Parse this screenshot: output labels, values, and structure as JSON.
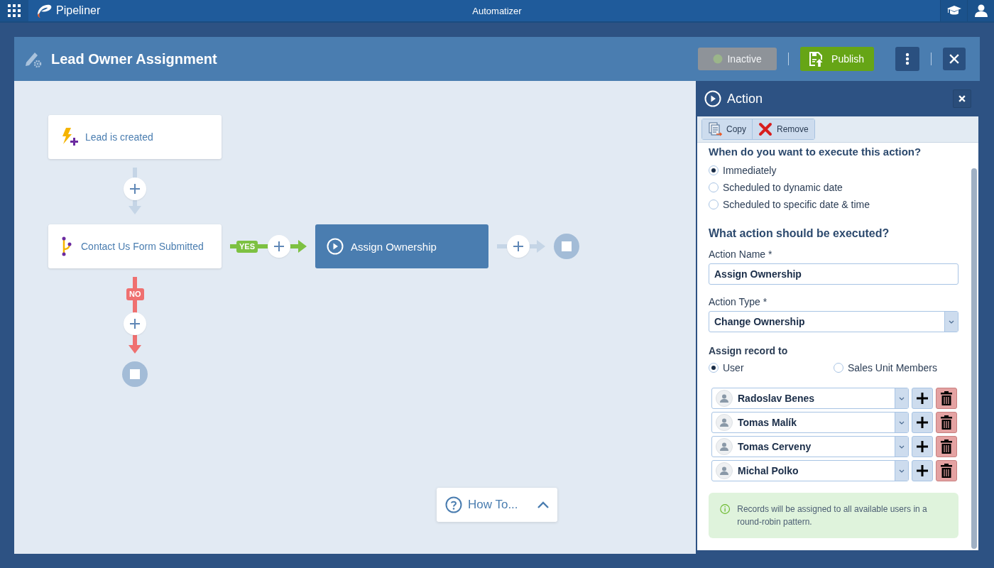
{
  "app_bar": {
    "app_name": "Pipeliner",
    "title": "Automatizer"
  },
  "workflow": {
    "title": "Lead Owner Assignment",
    "status_button": {
      "label": "Inactive",
      "disabled": true
    },
    "publish_button": "Publish"
  },
  "diagram": {
    "trigger": "Lead is created",
    "condition": "Contact Us Form Submitted",
    "yes_label": "YES",
    "no_label": "NO",
    "action": {
      "label": "Assign Ownership",
      "selected": true
    }
  },
  "how_to": {
    "label": "How To...",
    "expanded": false
  },
  "panel": {
    "title": "Action",
    "toolbar": [
      {
        "kind": "copy",
        "label": "Copy"
      },
      {
        "kind": "remove",
        "label": "Remove"
      }
    ],
    "schedule_question": "When do you want to execute this action?",
    "schedule_options": [
      {
        "label": "Immediately",
        "selected": true
      },
      {
        "label": "Scheduled to dynamic date",
        "selected": false
      },
      {
        "label": "Scheduled to specific date & time",
        "selected": false
      }
    ],
    "action_heading": "What action should be executed?",
    "action_name": {
      "label": "Action Name *",
      "value": "Assign Ownership"
    },
    "action_type": {
      "label": "Action Type *",
      "value": "Change Ownership"
    },
    "assign_heading": "Assign record to",
    "assign_options": [
      {
        "label": "User",
        "selected": true
      },
      {
        "label": "Sales Unit Members",
        "selected": false
      }
    ],
    "users": [
      "Radoslav Benes",
      "Tomas Malík",
      "Tomas Cerveny",
      "Michal Polko"
    ],
    "info": "Records will be assigned to all available users in a round-robin pattern."
  }
}
